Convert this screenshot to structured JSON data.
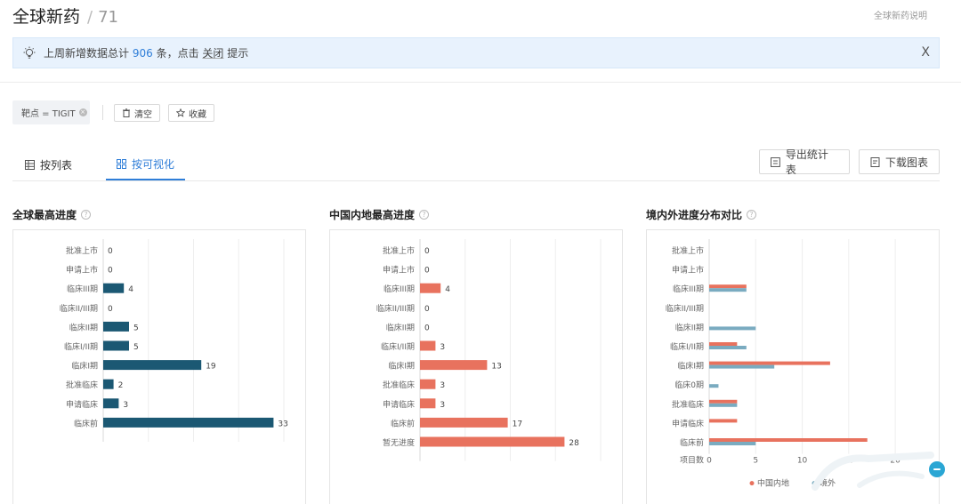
{
  "header": {
    "title": "全球新药",
    "separator": "/",
    "count": "71",
    "help_link": "全球新药说明"
  },
  "notice": {
    "prefix": "上周新增数据总计",
    "number": "906",
    "suffix": "条，点击",
    "action": "关闭",
    "tail": "提示",
    "close": "X"
  },
  "filters": {
    "chip": "靶点 = TIGIT",
    "clear": "清空",
    "favorite": "收藏"
  },
  "tabs": [
    {
      "label": "按列表",
      "active": false
    },
    {
      "label": "按可视化",
      "active": true
    }
  ],
  "actions": {
    "export": "导出统计表",
    "download": "下载图表"
  },
  "colors": {
    "accent": "#2f7ed8",
    "global_bar": "#1b5873",
    "china_bar": "#e8725e",
    "overseas_bar": "#7aabc0"
  },
  "chart_data": [
    {
      "type": "bar",
      "title": "全球最高进度",
      "categories": [
        "批准上市",
        "申请上市",
        "临床III期",
        "临床II/III期",
        "临床II期",
        "临床I/II期",
        "临床I期",
        "批准临床",
        "申请临床",
        "临床前"
      ],
      "values": [
        0,
        0,
        4,
        0,
        5,
        5,
        19,
        2,
        3,
        33
      ],
      "xlim": [
        0,
        35
      ]
    },
    {
      "type": "bar",
      "title": "中国内地最高进度",
      "categories": [
        "批准上市",
        "申请上市",
        "临床III期",
        "临床II/III期",
        "临床II期",
        "临床I/II期",
        "临床I期",
        "批准临床",
        "申请临床",
        "临床前",
        "暂无进度"
      ],
      "values": [
        0,
        0,
        4,
        0,
        0,
        3,
        13,
        3,
        3,
        17,
        28
      ],
      "xlim": [
        0,
        35
      ]
    },
    {
      "type": "bar",
      "title": "境内外进度分布对比",
      "categories": [
        "批准上市",
        "申请上市",
        "临床III期",
        "临床II/III期",
        "临床II期",
        "临床I/II期",
        "临床I期",
        "临床0期",
        "批准临床",
        "申请临床",
        "临床前"
      ],
      "series": [
        {
          "name": "中国内地",
          "values": [
            0,
            0,
            4,
            0,
            0,
            3,
            13,
            0,
            3,
            3,
            17
          ]
        },
        {
          "name": "境外",
          "values": [
            0,
            0,
            4,
            0,
            5,
            4,
            7,
            1,
            3,
            0,
            5
          ]
        }
      ],
      "xlabel": "项目数",
      "xticks": [
        "0",
        "5",
        "10",
        "15",
        "20"
      ],
      "xlim": [
        0,
        22
      ],
      "grid": true,
      "legend": "bottom"
    }
  ]
}
